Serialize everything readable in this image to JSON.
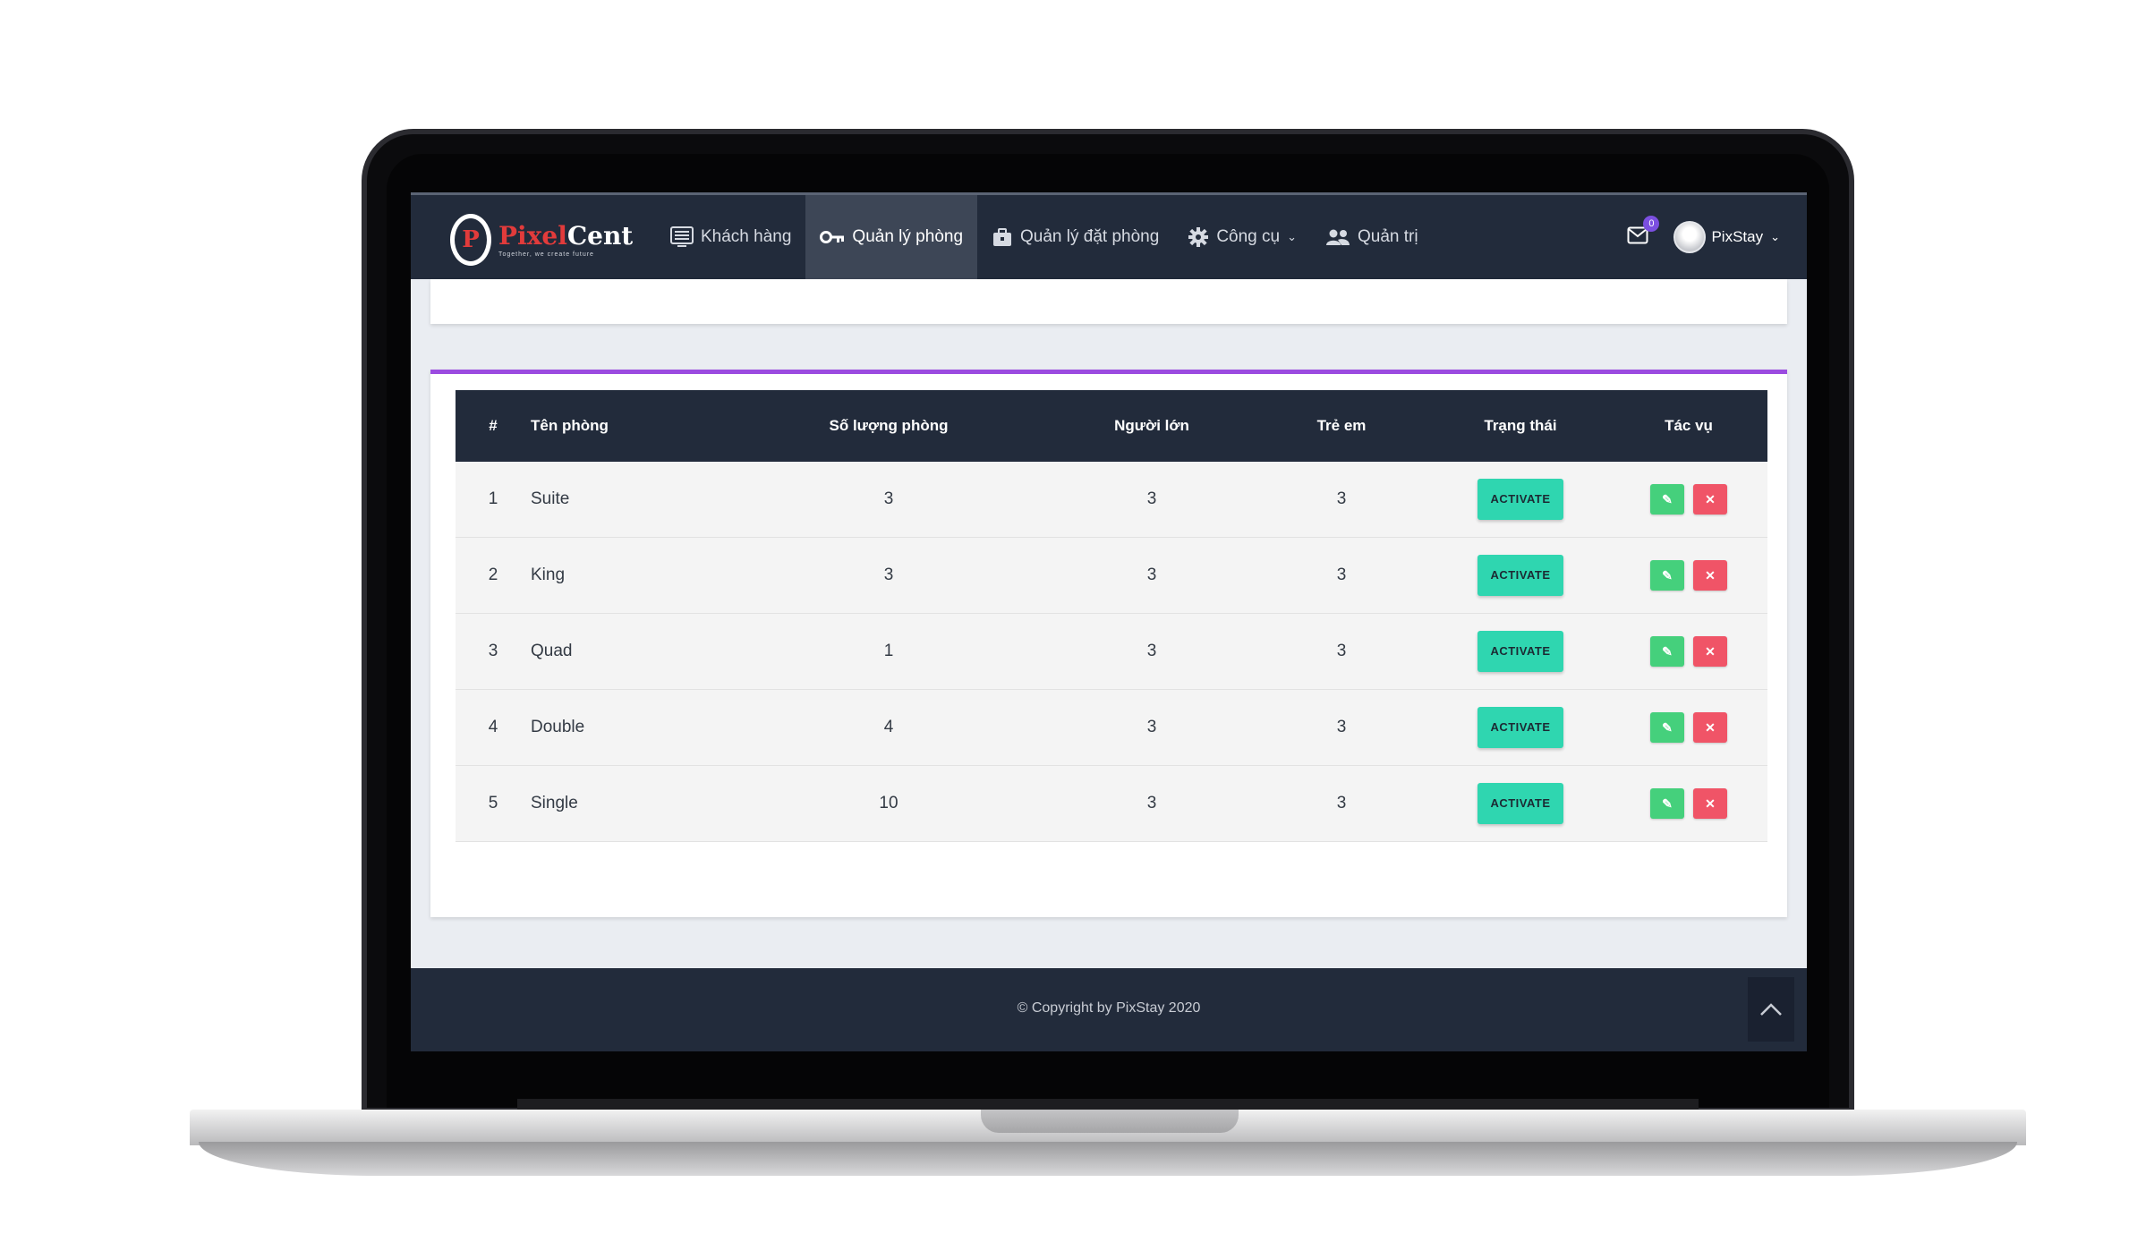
{
  "brand": {
    "mark": "P",
    "name_part1": "Pixel",
    "name_part2": "Cent",
    "tagline": "Together, we create future"
  },
  "nav": {
    "items": [
      {
        "label": "Khách hàng",
        "icon": "list-icon"
      },
      {
        "label": "Quản lý phòng",
        "icon": "key-icon",
        "active": true
      },
      {
        "label": "Quản lý đặt phòng",
        "icon": "briefcase-icon"
      },
      {
        "label": "Công cụ",
        "icon": "gear-icon",
        "dropdown": true
      },
      {
        "label": "Quản trị",
        "icon": "users-icon"
      }
    ],
    "mail_count": "0",
    "user_name": "PixStay"
  },
  "table": {
    "headers": [
      "#",
      "Tên phòng",
      "Số lượng phòng",
      "Người lớn",
      "Trẻ em",
      "Trạng thái",
      "Tác vụ"
    ],
    "rows": [
      {
        "num": "1",
        "name": "Suite",
        "qty": "3",
        "adults": "3",
        "children": "3",
        "status": "ACTIVATE"
      },
      {
        "num": "2",
        "name": "King",
        "qty": "3",
        "adults": "3",
        "children": "3",
        "status": "ACTIVATE"
      },
      {
        "num": "3",
        "name": "Quad",
        "qty": "1",
        "adults": "3",
        "children": "3",
        "status": "ACTIVATE"
      },
      {
        "num": "4",
        "name": "Double",
        "qty": "4",
        "adults": "3",
        "children": "3",
        "status": "ACTIVATE"
      },
      {
        "num": "5",
        "name": "Single",
        "qty": "10",
        "adults": "3",
        "children": "3",
        "status": "ACTIVATE"
      }
    ]
  },
  "footer": {
    "copyright": "© Copyright by PixStay 2020"
  },
  "colors": {
    "navbar": "#222b3b",
    "accent_border": "#9b4be0",
    "activate": "#2fd6b0",
    "edit": "#45d07c",
    "delete": "#f05467"
  }
}
